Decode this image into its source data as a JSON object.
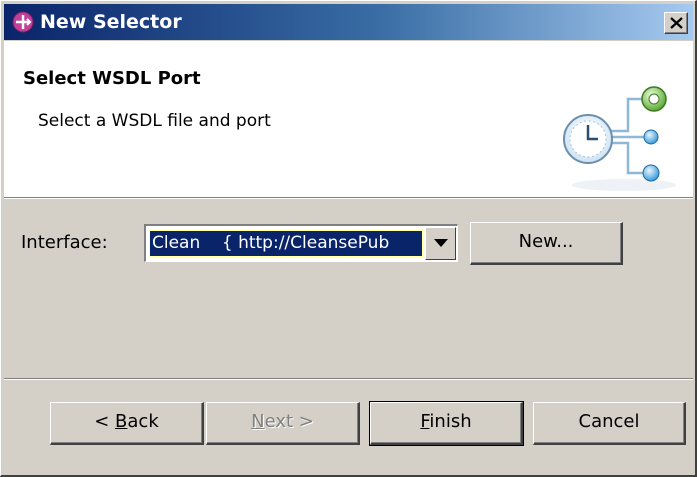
{
  "window": {
    "title": "New Selector"
  },
  "banner": {
    "title": "Select WSDL Port",
    "description": "Select a WSDL file and port",
    "graphic_icon": "wsdl-port-clock-icon"
  },
  "form": {
    "interface_label": "Interface:",
    "interface_value": "Clean    { http://CleansePub",
    "new_button": "New..."
  },
  "footer": {
    "back_prefix": "< ",
    "back_mnemonic": "B",
    "back_rest": "ack",
    "next_mnemonic": "N",
    "next_rest": "ext >",
    "finish_mnemonic": "F",
    "finish_rest": "inish",
    "cancel_label": "Cancel"
  },
  "colors": {
    "titlebar_start": "#0a246a",
    "titlebar_end": "#a6caf0",
    "dialog_face": "#d4d0c8",
    "selection": "#0a246a"
  }
}
